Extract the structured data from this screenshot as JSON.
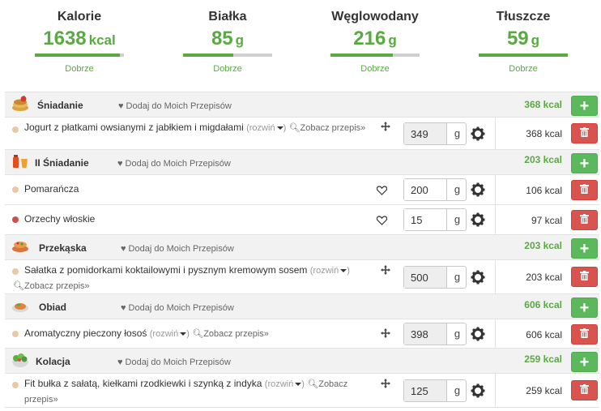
{
  "summary": [
    {
      "title": "Kalorie",
      "value": "1638",
      "unit": "kcal",
      "rating": "Dobrze",
      "progress": 0.95
    },
    {
      "title": "Białka",
      "value": "85",
      "unit": "g",
      "rating": "Dobrze",
      "progress": 0.56
    },
    {
      "title": "Węglowodany",
      "value": "216",
      "unit": "g",
      "rating": "Dobrze",
      "progress": 0.7
    },
    {
      "title": "Tłuszcze",
      "value": "59",
      "unit": "g",
      "rating": "Dobrze",
      "progress": 1.0
    }
  ],
  "favorite_label": "Dodaj do Moich Przepisów",
  "expand_label": "(rozwiń",
  "recipe_link": "Zobacz przepis»",
  "unit": "g",
  "meals": [
    {
      "name": "Śniadanie",
      "kcal": "368 kcal",
      "icon": "pancake-icon",
      "items": [
        {
          "name": "Jogurt z płatkami owsianymi z jabłkiem i migdałami",
          "amount": "349",
          "kcal": "368 kcal",
          "type": "recipe"
        }
      ]
    },
    {
      "name": "II Śniadanie",
      "kcal": "203 kcal",
      "icon": "juice-icon",
      "items": [
        {
          "name": "Pomarańcza",
          "amount": "200",
          "kcal": "106 kcal",
          "type": "product"
        },
        {
          "name": "Orzechy włoskie",
          "amount": "15",
          "kcal": "97 kcal",
          "type": "product"
        }
      ]
    },
    {
      "name": "Przekąska",
      "kcal": "203 kcal",
      "icon": "dish-icon",
      "items": [
        {
          "name": "Sałatka z pomidorkami koktailowymi i pysznym kremowym sosem",
          "amount": "500",
          "kcal": "203 kcal",
          "type": "recipe"
        }
      ]
    },
    {
      "name": "Obiad",
      "kcal": "606 kcal",
      "icon": "plate-icon",
      "items": [
        {
          "name": "Aromatyczny pieczony łosoś",
          "amount": "398",
          "kcal": "606 kcal",
          "type": "recipe"
        }
      ]
    },
    {
      "name": "Kolacja",
      "kcal": "259 kcal",
      "icon": "salad-icon",
      "items": [
        {
          "name": "Fit bułka z sałatą, kiełkami rzodkiewki i szynką z indyka",
          "amount": "125",
          "kcal": "259 kcal",
          "type": "recipe"
        }
      ]
    }
  ],
  "colors": {
    "accent": "#5aa942",
    "add_button": "#5cb85c",
    "delete_button": "#d9534f",
    "dot_light": "#e8c8a8",
    "dot_red": "#d05050"
  }
}
